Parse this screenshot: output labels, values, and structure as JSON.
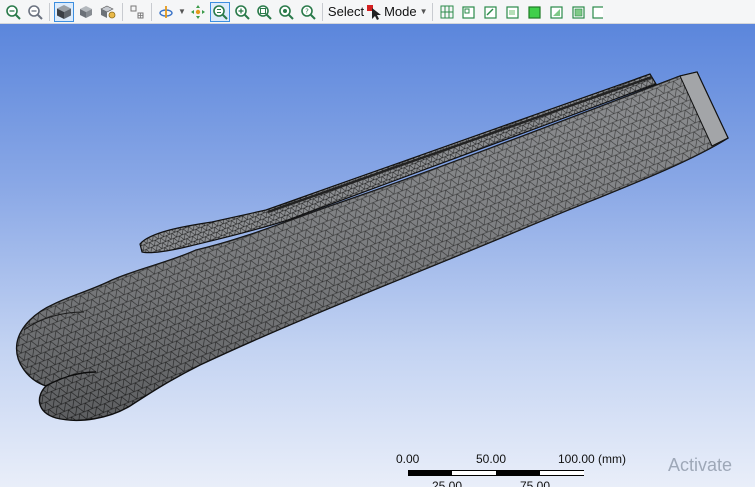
{
  "toolbar": {
    "select_label": "Select",
    "mode_label": "Mode"
  },
  "scale": {
    "labels_top": [
      "0.00",
      "50.00",
      "100.00 (mm)"
    ],
    "labels_bottom": [
      "25.00",
      "75.00"
    ]
  },
  "watermark": {
    "text": "Activate"
  },
  "colors": {
    "viewport_top": "#5b86dc",
    "viewport_bottom": "#e9eef9",
    "mesh_fill": "#7d7f82",
    "mesh_line": "#141414"
  }
}
